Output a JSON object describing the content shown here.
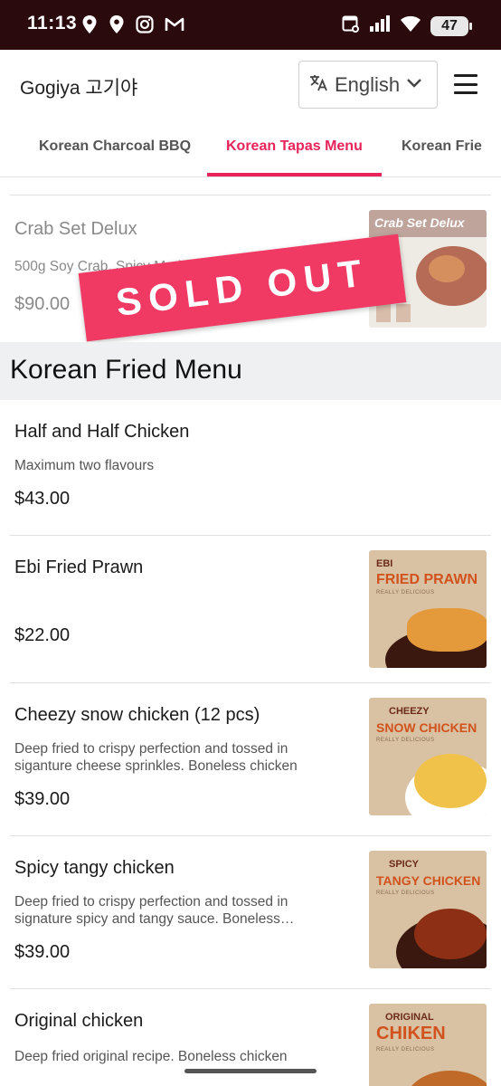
{
  "status_bar": {
    "time": "11:13",
    "battery": "47",
    "icons_left": [
      "location-icon",
      "location-icon",
      "instagram-icon",
      "gmail-icon"
    ],
    "icons_right": [
      "calendar-icon",
      "signal-icon",
      "wifi-icon",
      "battery-icon"
    ]
  },
  "header": {
    "brand": "Gogiya 고기야",
    "language": "English",
    "language_icon": "translate-icon",
    "menu_icon": "hamburger-icon"
  },
  "tabs": [
    {
      "label": "Korean Charcoal BBQ",
      "active": false
    },
    {
      "label": "Korean Tapas Menu",
      "active": true
    },
    {
      "label": "Korean Frie",
      "active": false
    }
  ],
  "colors": {
    "accent": "#e8245a",
    "sold_out": "#f03a64",
    "status_bar": "#2a0a0c",
    "section_bg": "#eef0f2"
  },
  "sold_out_item": {
    "name": "Crab Set Delux",
    "desc": "500g Soy Crab, Spicy Marinated Raw Crab",
    "price": "$90.00",
    "badge": "SOLD OUT",
    "thumb_title": "Crab Set Delux"
  },
  "section": {
    "title": "Korean Fried Menu"
  },
  "items": [
    {
      "name": "Half and Half Chicken",
      "desc": "Maximum two flavours",
      "price": "$43.00"
    },
    {
      "name": "Ebi Fried Prawn",
      "desc": "",
      "price": "$22.00",
      "thumb_small": "EBI",
      "thumb_big": "FRIED PRAWN",
      "thumb_sub": "REALLY DELICIOUS"
    },
    {
      "name": "Cheezy snow chicken (12 pcs)",
      "desc": "Deep fried to crispy perfection and tossed in siganture cheese sprinkles. Boneless chicken",
      "price": "$39.00",
      "thumb_small": "CHEEZY",
      "thumb_big": "SNOW CHICKEN",
      "thumb_sub": "REALLY DELICIOUS"
    },
    {
      "name": "Spicy tangy chicken",
      "desc": "Deep fried to crispy perfection and tossed in signature spicy and tangy sauce. Boneless…",
      "price": "$39.00",
      "thumb_small": "SPICY",
      "thumb_big": "TANGY CHICKEN",
      "thumb_sub": "REALLY DELICIOUS"
    },
    {
      "name": "Original chicken",
      "desc": "Deep fried original recipe. Boneless chicken",
      "price": "",
      "thumb_small": "ORIGINAL",
      "thumb_big": "CHIKEN",
      "thumb_sub": "REALLY DELICIOUS"
    }
  ]
}
